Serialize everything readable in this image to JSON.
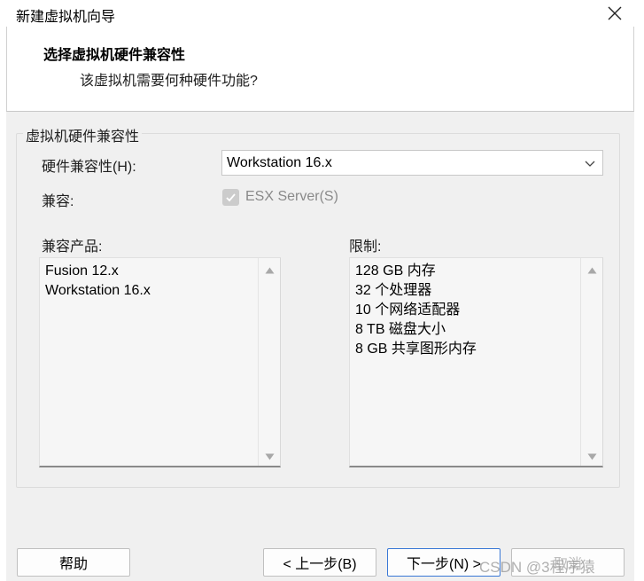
{
  "window": {
    "title": "新建虚拟机向导"
  },
  "header": {
    "title": "选择虚拟机硬件兼容性",
    "subtitle": "该虚拟机需要何种硬件功能?"
  },
  "group": {
    "label": "虚拟机硬件兼容性",
    "hw_compat_label": "硬件兼容性(H):",
    "hw_compat_value": "Workstation 16.x",
    "compat_label": "兼容:",
    "esx_checkbox_label": "ESX Server(S)",
    "esx_checked": true,
    "products_label": "兼容产品:",
    "products": [
      "Fusion 12.x",
      "Workstation 16.x"
    ],
    "limits_label": "限制:",
    "limits": [
      "128 GB 内存",
      "32 个处理器",
      "10 个网络适配器",
      "8 TB 磁盘大小",
      "8 GB 共享图形内存"
    ]
  },
  "buttons": {
    "help": "帮助",
    "back": "< 上一步(B)",
    "next": "下一步(N) >",
    "cancel": "取消"
  },
  "watermark": "CSDN @3程序猿",
  "colors": {
    "primary_border": "#3a78d6",
    "background": "#f0f0f0"
  }
}
